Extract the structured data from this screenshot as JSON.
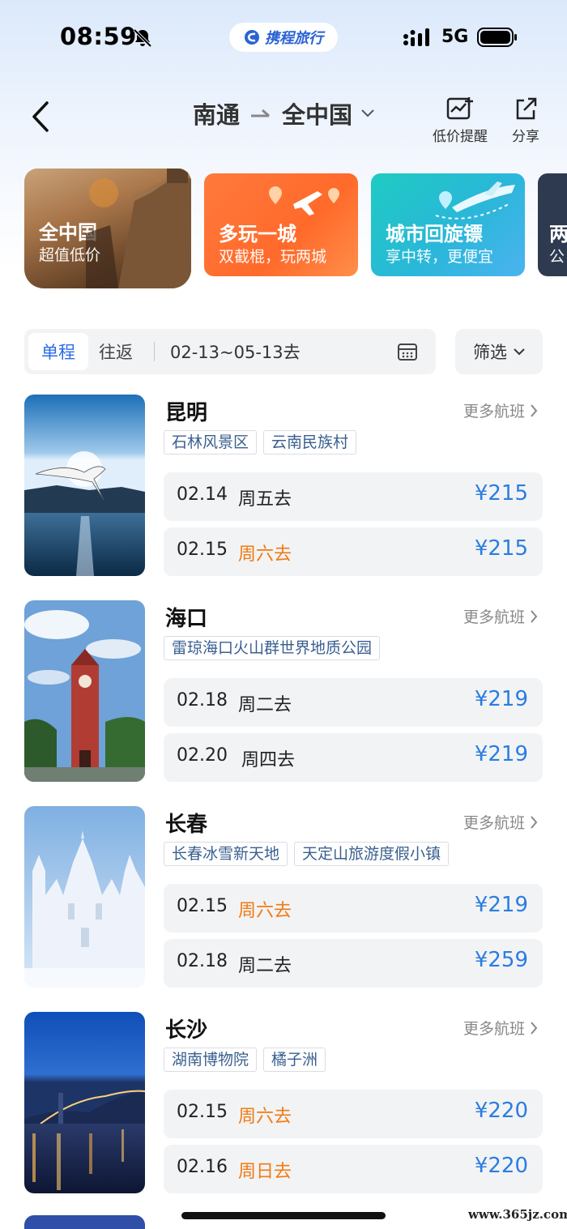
{
  "status_bar": {
    "time": "08:59",
    "brand": "携程旅行",
    "network": "5G",
    "icons": [
      "bell-muted-icon",
      "signal-icon",
      "battery-icon"
    ]
  },
  "nav": {
    "origin": "南通",
    "destination": "全中国",
    "alert_label": "低价提醒",
    "share_label": "分享",
    "icons": [
      "back-icon",
      "route-arrow-icon",
      "chevron-down-icon",
      "price-alert-icon",
      "share-icon"
    ]
  },
  "banners": [
    {
      "title": "全中国",
      "subtitle": "超值低价"
    },
    {
      "title": "多玩一城",
      "subtitle": "双截棍，玩两城"
    },
    {
      "title": "城市回旋镖",
      "subtitle": "享中转，更便宜"
    },
    {
      "title": "两",
      "subtitle": "公"
    }
  ],
  "filter": {
    "trip_oneway": "单程",
    "trip_round": "往返",
    "date_range": "02-13~05-13去",
    "filter_label": "筛选"
  },
  "more_flights_label": "更多航班",
  "destinations": [
    {
      "city": "昆明",
      "tags": [
        "石林风景区",
        "云南民族村"
      ],
      "flights": [
        {
          "date": "02.14",
          "day": "周五去",
          "price": "¥215"
        },
        {
          "date": "02.15",
          "day": "周六去",
          "price": "¥215"
        }
      ]
    },
    {
      "city": "海口",
      "tags": [
        "雷琼海口火山群世界地质公园"
      ],
      "flights": [
        {
          "date": "02.18",
          "day": "周二去",
          "price": "¥219"
        },
        {
          "date": "02.20",
          "day": "周四去",
          "price": "¥219"
        }
      ]
    },
    {
      "city": "长春",
      "tags": [
        "长春冰雪新天地",
        "天定山旅游度假小镇"
      ],
      "flights": [
        {
          "date": "02.15",
          "day": "周六去",
          "price": "¥219"
        },
        {
          "date": "02.18",
          "day": "周二去",
          "price": "¥259"
        }
      ]
    },
    {
      "city": "长沙",
      "tags": [
        "湖南博物院",
        "橘子洲"
      ],
      "flights": [
        {
          "date": "02.15",
          "day": "周六去",
          "price": "¥220"
        },
        {
          "date": "02.16",
          "day": "周日去",
          "price": "¥220"
        }
      ]
    }
  ],
  "colors": {
    "accent_blue": "#2b6de5",
    "price_blue": "#2b7de0",
    "weekend_orange": "#f27a12"
  },
  "watermark": "www.365jz.com"
}
